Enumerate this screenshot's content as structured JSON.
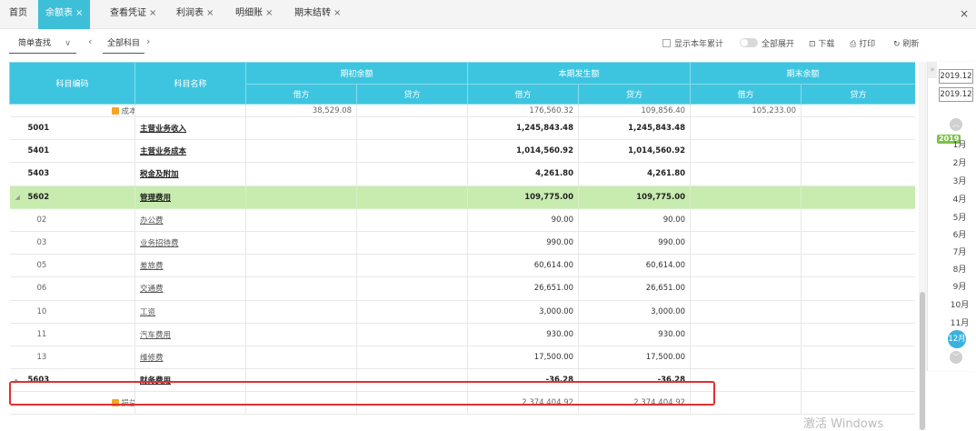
{
  "tabs": [
    {
      "label": "首页",
      "closable": false,
      "active": false
    },
    {
      "label": "余额表",
      "closable": true,
      "active": true
    },
    {
      "label": "查看凭证",
      "closable": true,
      "active": false
    },
    {
      "label": "利润表",
      "closable": true,
      "active": false
    },
    {
      "label": "明细账",
      "closable": true,
      "active": false
    },
    {
      "label": "期末结转",
      "closable": true,
      "active": false
    }
  ],
  "window_close": "×",
  "toolbar": {
    "search_mode": "简单查找",
    "breadcrumb": "全部科目",
    "show_year_total": "显示本年累计",
    "expand_all": "全部展开",
    "download": "下载",
    "print": "打印",
    "refresh": "刷新"
  },
  "table": {
    "headers": {
      "code": "科目编码",
      "name": "科目名称",
      "opening": "期初余额",
      "period": "本期发生额",
      "closing": "期末余额",
      "debit": "借方",
      "credit": "贷方"
    },
    "top_row": {
      "label": "成本小计",
      "open_debit": "38,529.08",
      "period_debit": "176,560.32",
      "period_credit": "109,856.40",
      "close_debit": "105,233.00"
    },
    "rows": [
      {
        "code": "5001",
        "name": "主营业务收入",
        "period_debit": "1,245,843.48",
        "period_credit": "1,245,843.48"
      },
      {
        "code": "5401",
        "name": "主营业务成本",
        "period_debit": "1,014,560.92",
        "period_credit": "1,014,560.92"
      },
      {
        "code": "5403",
        "name": "税金及附加",
        "period_debit": "4,261.80",
        "period_credit": "4,261.80"
      },
      {
        "code": "5602",
        "name": "管理费用",
        "period_debit": "109,775.00",
        "period_credit": "109,775.00"
      },
      {
        "code": "02",
        "name": "办公费",
        "period_debit": "90.00",
        "period_credit": "90.00"
      },
      {
        "code": "03",
        "name": "业务招待费",
        "period_debit": "990.00",
        "period_credit": "990.00"
      },
      {
        "code": "05",
        "name": "差旅费",
        "period_debit": "60,614.00",
        "period_credit": "60,614.00"
      },
      {
        "code": "06",
        "name": "交通费",
        "period_debit": "26,651.00",
        "period_credit": "26,651.00"
      },
      {
        "code": "10",
        "name": "工资",
        "period_debit": "3,000.00",
        "period_credit": "3,000.00"
      },
      {
        "code": "11",
        "name": "汽车费用",
        "period_debit": "930.00",
        "period_credit": "930.00"
      },
      {
        "code": "13",
        "name": "维修费",
        "period_debit": "17,500.00",
        "period_credit": "17,500.00"
      },
      {
        "code": "5603",
        "name": "财务费用",
        "period_debit": "-36.28",
        "period_credit": "-36.28"
      }
    ],
    "bottom_row": {
      "label": "损益小计",
      "period_debit": "2,374,404.92",
      "period_credit": "2,374,404.92"
    }
  },
  "date_panel": {
    "start_period": "2019.12",
    "end_period": "2019.12",
    "year_badge": "2019",
    "months": [
      "1月",
      "2月",
      "3月",
      "4月",
      "5月",
      "6月",
      "7月",
      "8月",
      "9月",
      "10月",
      "11月"
    ],
    "selected_month": "12月"
  },
  "watermark": "激活 Windows",
  "colors": {
    "header_bg": "#3dc5e0",
    "active_tab": "#3dbfd8",
    "highlight_row": "#c8ecb0",
    "red_box": "#e03030"
  }
}
